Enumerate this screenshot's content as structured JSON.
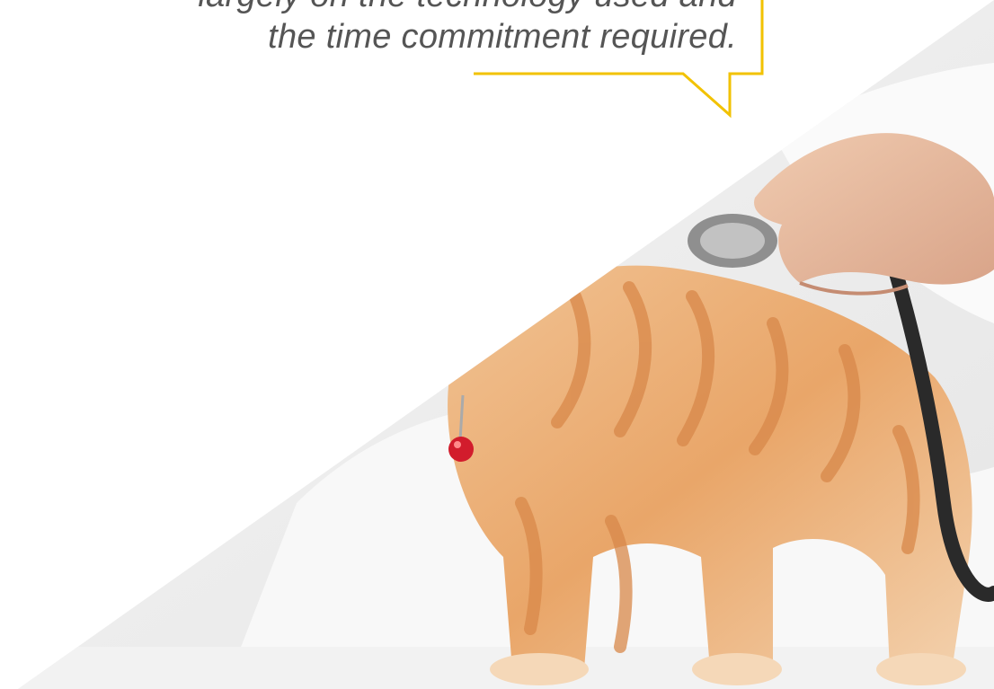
{
  "quote": {
    "line1": "largely on the technology used and",
    "line2": "the time commitment required."
  },
  "photo": {
    "subject": "orange tabby kitten being examined with a stethoscope",
    "icon": "cat-photo"
  },
  "colors": {
    "accent": "#f2c200",
    "text": "#555555",
    "background": "#ffffff"
  }
}
